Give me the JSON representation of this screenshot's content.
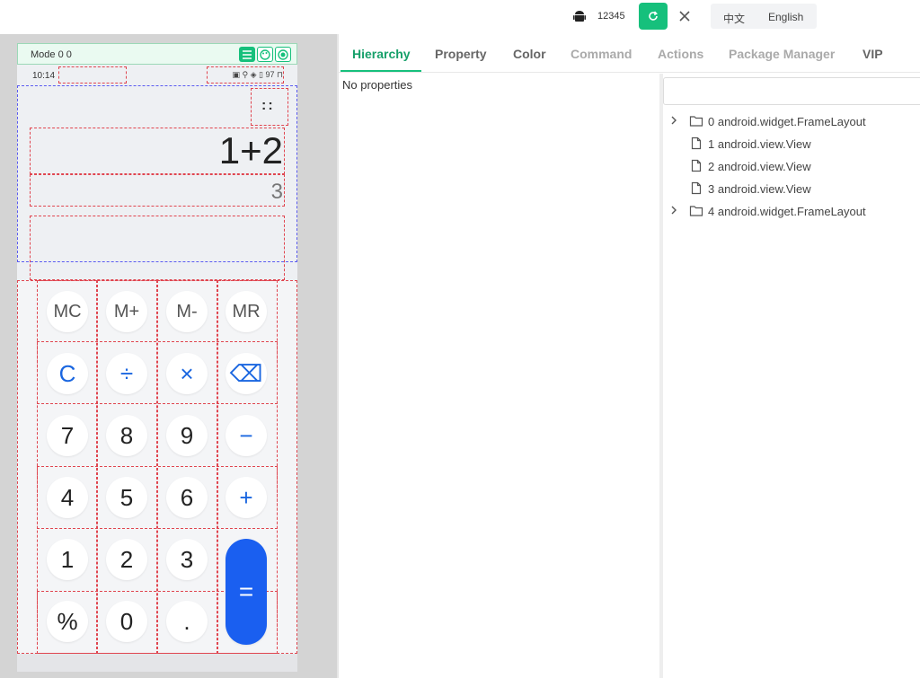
{
  "topbar": {
    "device_id": "12345",
    "lang_zh": "中文",
    "lang_en": "English"
  },
  "phone": {
    "mode_label": "Mode 0 0",
    "status_time": "10:14",
    "status_right": "▣ ⚲ ◈ ▯ 97 ⊓",
    "more_label": "::",
    "expression": "1+2",
    "result": "3",
    "keys": {
      "mc": "MC",
      "mplus": "M+",
      "mminus": "M-",
      "mr": "MR",
      "clear": "C",
      "divide": "÷",
      "multiply": "×",
      "backspace": "⌫",
      "k7": "7",
      "k8": "8",
      "k9": "9",
      "minus": "−",
      "k4": "4",
      "k5": "5",
      "k6": "6",
      "plus": "+",
      "k1": "1",
      "k2": "2",
      "k3": "3",
      "equals": "=",
      "percent": "%",
      "k0": "0",
      "dot": "."
    }
  },
  "tabs": {
    "hierarchy": "Hierarchy",
    "property": "Property",
    "color": "Color",
    "command": "Command",
    "actions": "Actions",
    "package_manager": "Package Manager",
    "vip": "VIP"
  },
  "property_panel": {
    "empty_text": "No properties"
  },
  "tree": {
    "search_value": "",
    "nodes": [
      {
        "label": "0 android.widget.FrameLayout",
        "kind": "folder"
      },
      {
        "label": "1 android.view.View",
        "kind": "file"
      },
      {
        "label": "2 android.view.View",
        "kind": "file"
      },
      {
        "label": "3 android.view.View",
        "kind": "file"
      },
      {
        "label": "4 android.widget.FrameLayout",
        "kind": "folder"
      }
    ]
  },
  "colors": {
    "accent": "#16c07c",
    "accent_text": "#16a06a",
    "op_blue": "#1a66e0",
    "equals_blue": "#1a5ff0"
  },
  "icons": {
    "android": "android-icon",
    "refresh": "refresh-icon",
    "close": "close-icon",
    "folder": "folder-icon",
    "file": "file-icon",
    "chevron": "chevron-right-icon"
  }
}
